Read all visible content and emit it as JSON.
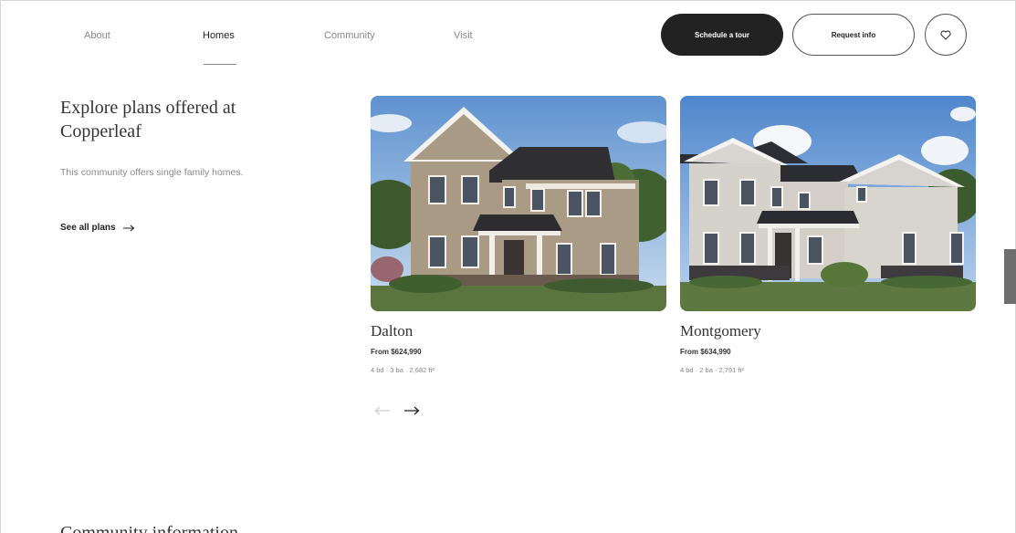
{
  "nav": {
    "tabs": [
      {
        "label": "About"
      },
      {
        "label": "Homes"
      },
      {
        "label": "Community"
      },
      {
        "label": "Visit"
      }
    ],
    "active_tab": "Homes",
    "schedule_label": "Schedule a tour",
    "request_label": "Request info",
    "heart_icon": "heart-icon"
  },
  "intro": {
    "heading": "Explore plans offered at Copperleaf",
    "description": "This community offers single family homes.",
    "see_all_label": "See all plans",
    "arrow_icon": "arrow-right-icon"
  },
  "plans": [
    {
      "name": "Dalton",
      "price": "From $624,990",
      "specs": "4 bd · 3 ba · 2,682 ft²"
    },
    {
      "name": "Montgomery",
      "price": "From $634,990",
      "specs": "4 bd · 2 ba · 2,791 ft²"
    }
  ],
  "carousel": {
    "prev_icon": "arrow-left-icon",
    "next_icon": "arrow-right-icon"
  },
  "bottom": {
    "heading": "Community information"
  },
  "colors": {
    "dark": "#222222",
    "muted": "#8a8a8a",
    "sky": "#6f9ed4",
    "grass": "#5f7a44"
  }
}
